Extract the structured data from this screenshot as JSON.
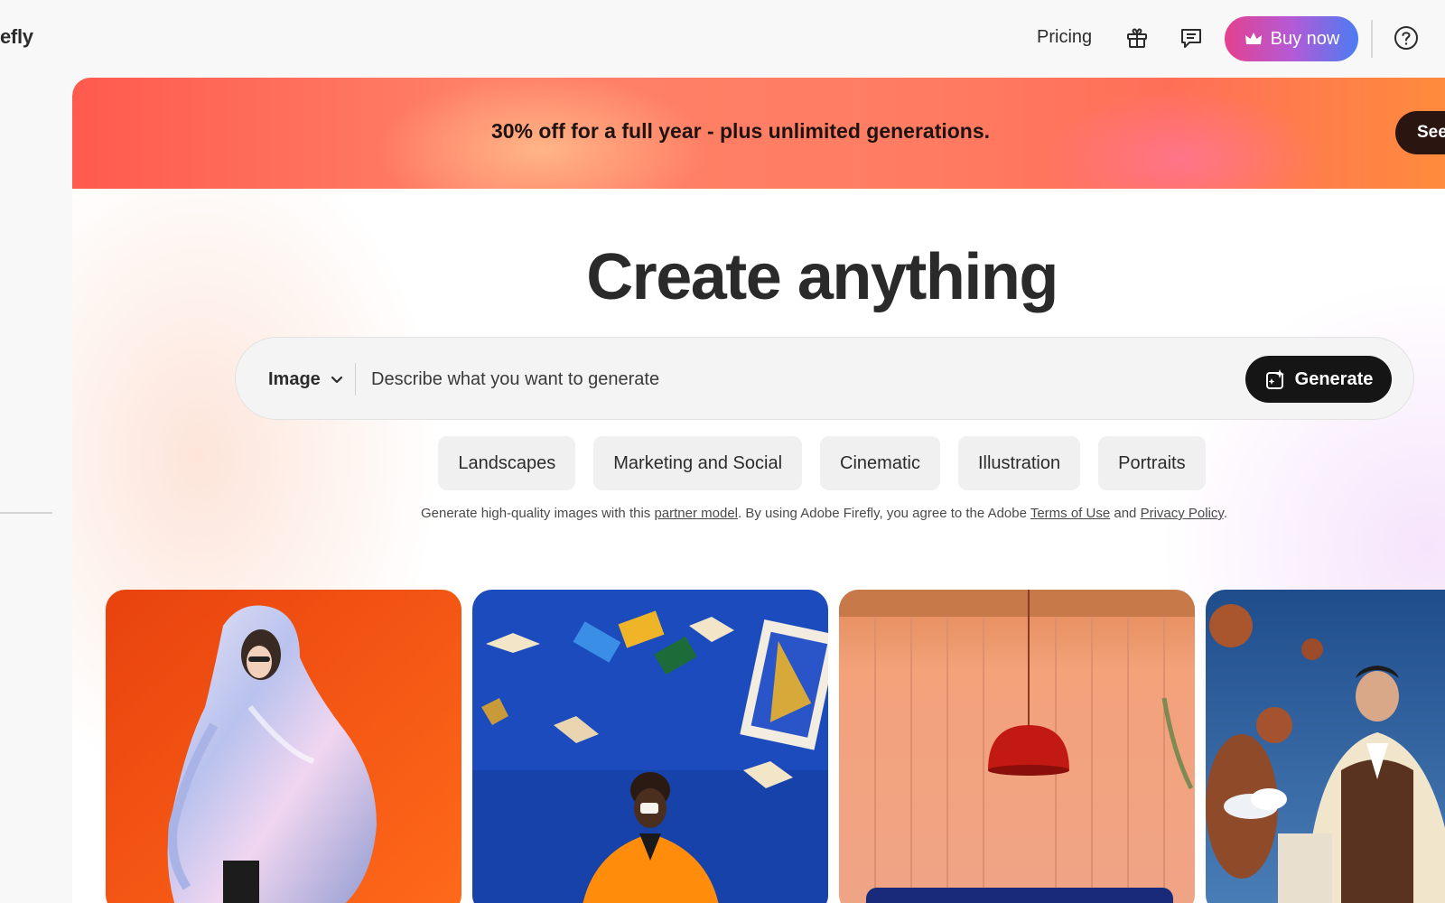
{
  "app": {
    "title_fragment": "efly"
  },
  "header": {
    "pricing_label": "Pricing",
    "buy_label": "Buy now",
    "icons": [
      "gift-icon",
      "chat-icon",
      "crown-icon",
      "help-icon"
    ]
  },
  "promo": {
    "text": "30% off for a full year  - plus unlimited generations.",
    "button_label": "See"
  },
  "hero": {
    "title": "Create anything"
  },
  "prompt": {
    "type_selected": "Image",
    "placeholder": "Describe what you want to generate",
    "value": "",
    "generate_label": "Generate"
  },
  "chips": [
    "Landscapes",
    "Marketing and Social",
    "Cinematic",
    "Illustration",
    "Portraits"
  ],
  "disclaimer": {
    "prefix": "Generate high-quality images with this ",
    "partner_link": "partner model",
    "middle": ".  By using Adobe Firefly, you agree to the Adobe ",
    "terms_link": "Terms of Use",
    "and": " and ",
    "privacy_link": "Privacy Policy",
    "suffix": "."
  },
  "gallery": {
    "cards": [
      {
        "subject": "woman in iridescent puffer jacket on orange background"
      },
      {
        "subject": "man drinking coffee among floating books on blue background"
      },
      {
        "subject": "red pendant lamp over peach slatted wall"
      },
      {
        "subject": "man in varsity jacket with floating basketballs against sky"
      }
    ]
  },
  "colors": {
    "accent_gradient_start": "#e4418e",
    "accent_gradient_end": "#4b7cf2",
    "promo_start": "#ff5a4e",
    "promo_end": "#ff8b3d",
    "generate_button": "#151515"
  }
}
